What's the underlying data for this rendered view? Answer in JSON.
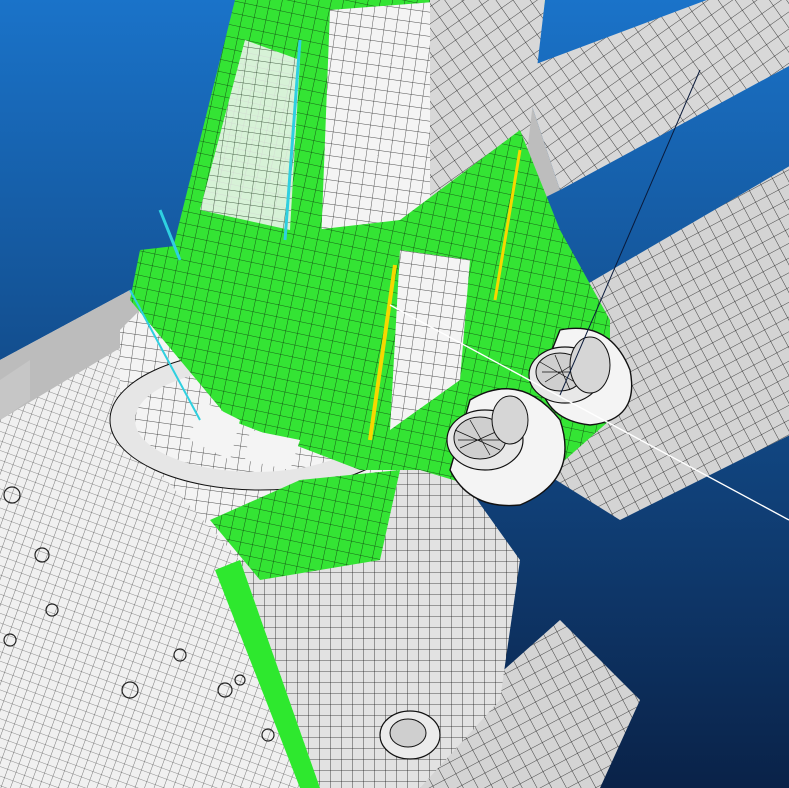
{
  "scene": {
    "background_top": "#1a73c9",
    "background_bottom": "#0a2248",
    "mesh_face_color": "#dcdcdc",
    "mesh_edge_color": "#1a1a1a",
    "contour_colors": {
      "low": "#ffffff",
      "band_1": "#2fd0e0",
      "band_2": "#2ee82e",
      "high": "#f5d800"
    }
  }
}
